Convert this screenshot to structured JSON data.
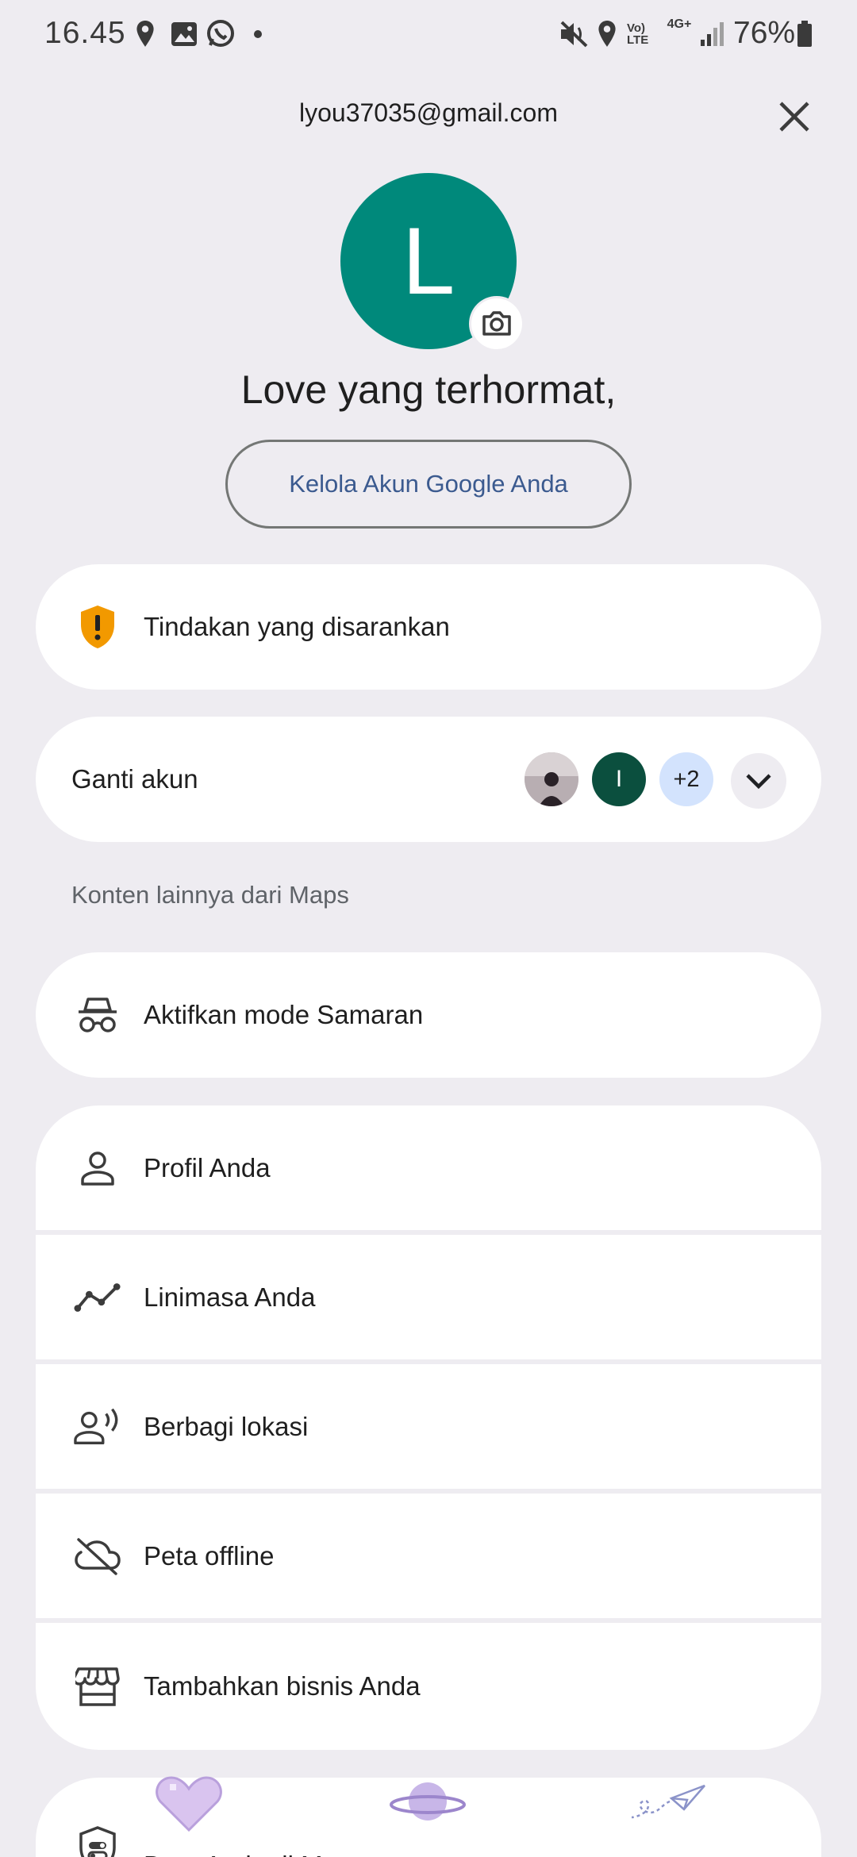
{
  "status_bar": {
    "time": "16.45",
    "battery": "76%",
    "icons": [
      "location-icon",
      "gallery-icon",
      "whatsapp-icon",
      "dot-icon",
      "mute-icon",
      "location-icon",
      "volte-icon",
      "4g-icon",
      "signal-icon",
      "battery-icon"
    ],
    "volte_label": "Vo) LTE",
    "network_label": "4G+"
  },
  "header": {
    "email": "lyou37035@gmail.com",
    "avatar_letter": "L",
    "avatar_color": "#00897b",
    "greeting": "Love yang terhormat,",
    "manage_button": "Kelola Akun Google Anda"
  },
  "recommended_action": {
    "label": "Tindakan yang disarankan",
    "icon": "shield-alert-icon",
    "icon_color": "#f29900"
  },
  "switch_account": {
    "label": "Ganti akun",
    "accounts": [
      {
        "type": "photo",
        "letter": ""
      },
      {
        "type": "letter",
        "letter": "I",
        "color": "#0b4f3e"
      },
      {
        "type": "more",
        "letter": "+2",
        "color": "#d3e3fd"
      }
    ]
  },
  "section_label": "Konten lainnya dari Maps",
  "incognito": {
    "label": "Aktifkan mode Samaran",
    "icon": "incognito-icon"
  },
  "menu_items": [
    {
      "label": "Profil Anda",
      "icon": "person-icon"
    },
    {
      "label": "Linimasa Anda",
      "icon": "timeline-icon"
    },
    {
      "label": "Berbagi lokasi",
      "icon": "location-sharing-icon"
    },
    {
      "label": "Peta offline",
      "icon": "cloud-off-icon"
    },
    {
      "label": "Tambahkan bisnis Anda",
      "icon": "storefront-icon"
    }
  ],
  "data_item": {
    "label": "Data Anda di Maps",
    "icon": "privacy-shield-icon"
  }
}
